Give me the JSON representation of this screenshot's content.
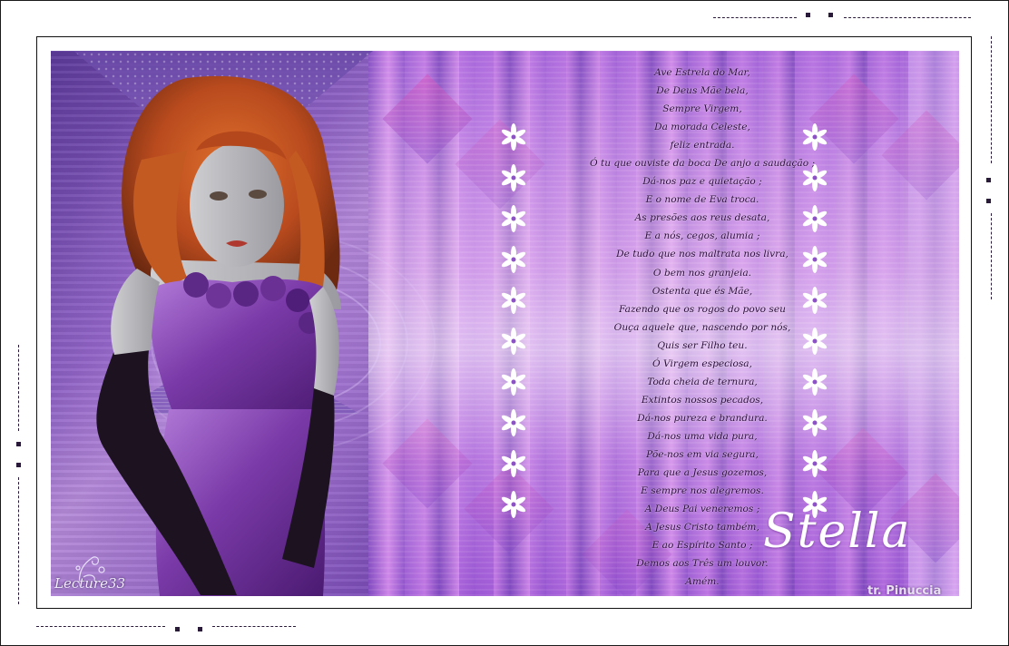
{
  "artwork": {
    "title": "Stella",
    "credit": "tr. Pinuccia",
    "watermark": "Lecture33",
    "poem_lines": [
      "Ave Estrela do Mar,",
      "De Deus Mãe bela,",
      "Sempre Virgem,",
      "Da morada Celeste,",
      "feliz entrada.",
      "Ó tu que ouviste da boca De anjo a saudação ;",
      "Dá-nos paz e quietação ;",
      "E o nome de Eva troca.",
      "As presões aos reus desata,",
      "E a nós, cegos, alumia ;",
      "De tudo que nos maltrata nos livra,",
      "O bem nos granjeia.",
      "Ostenta que és Mãe,",
      "Fazendo que os rogos do povo seu",
      "Ouça aquele que, nascendo por nós,",
      "Quis ser Filho teu.",
      "Ó Virgem especiosa,",
      "Toda cheia de ternura,",
      "Extintos nossos pecados,",
      "Dá-nos pureza e brandura.",
      "Dá-nos uma vida pura,",
      "Põe-nos em via segura,",
      "Para que a Jesus gozemos,",
      "E sempre nos alegremos.",
      "A Deus Pai veneremos ;",
      "A Jesus Cristo também,",
      "E ao Espírito Santo ;",
      "Demos aos Três um louvor.",
      "Amém."
    ]
  },
  "colors": {
    "accent_purple": "#8d52c6",
    "frame_dark": "#111111",
    "text_dark": "#2a0a3a",
    "script_white": "#ffffff"
  }
}
